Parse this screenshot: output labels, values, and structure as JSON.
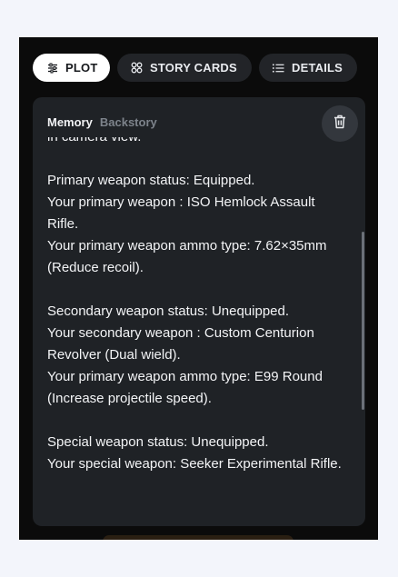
{
  "tabs": {
    "plot": {
      "label": "PLOT",
      "icon": "sliders-icon",
      "active": true
    },
    "story_cards": {
      "label": "STORY CARDS",
      "icon": "grid-icon"
    },
    "details": {
      "label": "DETAILS",
      "icon": "list-icon"
    }
  },
  "card": {
    "title": "Memory",
    "subtitle": "Backstory",
    "delete_icon": "trash-icon",
    "text": "in camera view.\n\nPrimary weapon status: Equipped.\nYour primary weapon : ISO Hemlock Assault Rifle.\nYour primary weapon ammo type: 7.62×35mm (Reduce recoil).\n\nSecondary weapon status: Unequipped.\nYour secondary weapon : Custom Centurion Revolver (Dual wield).\nYour primary weapon ammo type: E99 Round (Increase projectile speed).\n\nSpecial weapon status: Unequipped.\nYour special weapon: Seeker Experimental Rifle."
  },
  "colors": {
    "page_bg": "#f3f5fb",
    "panel_bg": "#0b0b0b",
    "card_bg": "#1f2226",
    "active_tab": "#ffffff",
    "inactive_tab": "#222428"
  }
}
